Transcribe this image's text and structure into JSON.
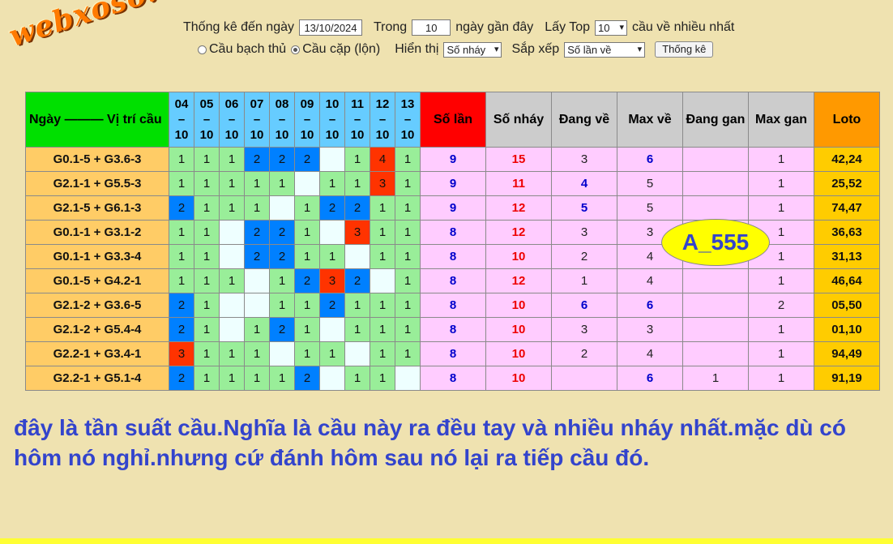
{
  "logo": "webxoso.net",
  "controls": {
    "thong_ke_label": "Thống kê đến ngày",
    "date_value": "13/10/2024",
    "trong_label": "Trong",
    "days_value": "10",
    "days_suffix": "ngày gần đây",
    "lay_top_label": "Lấy Top",
    "top_value": "10",
    "top_suffix": "cầu về nhiều nhất",
    "radio_bach_thu": "Cầu bạch thủ",
    "radio_cap": "Cầu cặp (lộn)",
    "hien_thi_label": "Hiển thị",
    "hien_thi_value": "Số nháy",
    "sap_xep_label": "Sắp xếp",
    "sap_xep_value": "Số lần về",
    "submit_label": "Thống kê"
  },
  "table": {
    "headers": {
      "ngay": "Ngày ——— Vị trí cầu",
      "so_lan": "Số lần",
      "so_nhay": "Số nháy",
      "dang_ve": "Đang về",
      "max_ve": "Max về",
      "dang_gan": "Đang gan",
      "max_gan": "Max gan",
      "loto": "Loto"
    },
    "dates": [
      {
        "d": "04",
        "sep": "–",
        "m": "10"
      },
      {
        "d": "05",
        "sep": "–",
        "m": "10"
      },
      {
        "d": "06",
        "sep": "–",
        "m": "10"
      },
      {
        "d": "07",
        "sep": "–",
        "m": "10"
      },
      {
        "d": "08",
        "sep": "–",
        "m": "10"
      },
      {
        "d": "09",
        "sep": "–",
        "m": "10"
      },
      {
        "d": "10",
        "sep": "–",
        "m": "10"
      },
      {
        "d": "11",
        "sep": "–",
        "m": "10"
      },
      {
        "d": "12",
        "sep": "–",
        "m": "10"
      },
      {
        "d": "13",
        "sep": "–",
        "m": "10"
      }
    ],
    "rows": [
      {
        "name": "G0.1-5 + G3.6-3",
        "cells": [
          "1",
          "1",
          "1",
          "2",
          "2",
          "2",
          "",
          "1",
          "4",
          "1"
        ],
        "so_lan": "9",
        "so_nhay": "15",
        "dang_ve": "3",
        "dang_ve_hi": false,
        "max_ve": "6",
        "max_ve_hi": true,
        "dang_gan": "",
        "max_gan": "1",
        "loto": "42,24"
      },
      {
        "name": "G2.1-1 + G5.5-3",
        "cells": [
          "1",
          "1",
          "1",
          "1",
          "1",
          "",
          "1",
          "1",
          "3",
          "1"
        ],
        "so_lan": "9",
        "so_nhay": "11",
        "dang_ve": "4",
        "dang_ve_hi": true,
        "max_ve": "5",
        "max_ve_hi": false,
        "dang_gan": "",
        "max_gan": "1",
        "loto": "25,52"
      },
      {
        "name": "G2.1-5 + G6.1-3",
        "cells": [
          "2",
          "1",
          "1",
          "1",
          "",
          "1",
          "2",
          "2",
          "1",
          "1"
        ],
        "so_lan": "9",
        "so_nhay": "12",
        "dang_ve": "5",
        "dang_ve_hi": true,
        "max_ve": "5",
        "max_ve_hi": false,
        "dang_gan": "",
        "max_gan": "1",
        "loto": "74,47"
      },
      {
        "name": "G0.1-1 + G3.1-2",
        "cells": [
          "1",
          "1",
          "",
          "2",
          "2",
          "1",
          "",
          "3",
          "1",
          "1"
        ],
        "so_lan": "8",
        "so_nhay": "12",
        "dang_ve": "3",
        "dang_ve_hi": false,
        "max_ve": "3",
        "max_ve_hi": false,
        "dang_gan": "",
        "max_gan": "1",
        "loto": "36,63"
      },
      {
        "name": "G0.1-1 + G3.3-4",
        "cells": [
          "1",
          "1",
          "",
          "2",
          "2",
          "1",
          "1",
          "",
          "1",
          "1"
        ],
        "so_lan": "8",
        "so_nhay": "10",
        "dang_ve": "2",
        "dang_ve_hi": false,
        "max_ve": "4",
        "max_ve_hi": false,
        "dang_gan": "",
        "max_gan": "1",
        "loto": "31,13"
      },
      {
        "name": "G0.1-5 + G4.2-1",
        "cells": [
          "1",
          "1",
          "1",
          "",
          "1",
          "2",
          "3",
          "2",
          "",
          "1"
        ],
        "so_lan": "8",
        "so_nhay": "12",
        "dang_ve": "1",
        "dang_ve_hi": false,
        "max_ve": "4",
        "max_ve_hi": false,
        "dang_gan": "",
        "max_gan": "1",
        "loto": "46,64"
      },
      {
        "name": "G2.1-2 + G3.6-5",
        "cells": [
          "2",
          "1",
          "",
          "",
          "1",
          "1",
          "2",
          "1",
          "1",
          "1"
        ],
        "so_lan": "8",
        "so_nhay": "10",
        "dang_ve": "6",
        "dang_ve_hi": true,
        "max_ve": "6",
        "max_ve_hi": true,
        "dang_gan": "",
        "max_gan": "2",
        "loto": "05,50"
      },
      {
        "name": "G2.1-2 + G5.4-4",
        "cells": [
          "2",
          "1",
          "",
          "1",
          "2",
          "1",
          "",
          "1",
          "1",
          "1"
        ],
        "so_lan": "8",
        "so_nhay": "10",
        "dang_ve": "3",
        "dang_ve_hi": false,
        "max_ve": "3",
        "max_ve_hi": false,
        "dang_gan": "",
        "max_gan": "1",
        "loto": "01,10"
      },
      {
        "name": "G2.2-1 + G3.4-1",
        "cells": [
          "3",
          "1",
          "1",
          "1",
          "",
          "1",
          "1",
          "",
          "1",
          "1"
        ],
        "so_lan": "8",
        "so_nhay": "10",
        "dang_ve": "2",
        "dang_ve_hi": false,
        "max_ve": "4",
        "max_ve_hi": false,
        "dang_gan": "",
        "max_gan": "1",
        "loto": "94,49"
      },
      {
        "name": "G2.2-1 + G5.1-4",
        "cells": [
          "2",
          "1",
          "1",
          "1",
          "1",
          "2",
          "",
          "1",
          "1",
          ""
        ],
        "so_lan": "8",
        "so_nhay": "10",
        "dang_ve": "",
        "dang_ve_hi": false,
        "max_ve": "6",
        "max_ve_hi": true,
        "dang_gan": "1",
        "max_gan": "1",
        "loto": "91,19"
      }
    ]
  },
  "stamp": "A_555",
  "note": "đây là tần suất cầu.Nghĩa là cầu này ra đều tay và nhiều nháy nhất.mặc dù có hôm nó nghỉ.nhưng cứ đánh hôm sau nó lại ra tiếp cầu đó.",
  "colors": {
    "background": "#efe2b0",
    "header_ngay": "#00e000",
    "header_dates": "#66ccff",
    "header_so_lan": "#ff0000",
    "header_gray": "#cccccc",
    "header_loto": "#ff9900",
    "cell_1": "#99ee99",
    "cell_2": "#0080ff",
    "cell_hot": "#ff3300",
    "stats_bg": "#ffccff",
    "loto_bg": "#ffcc00",
    "note_text": "#3344cc"
  }
}
